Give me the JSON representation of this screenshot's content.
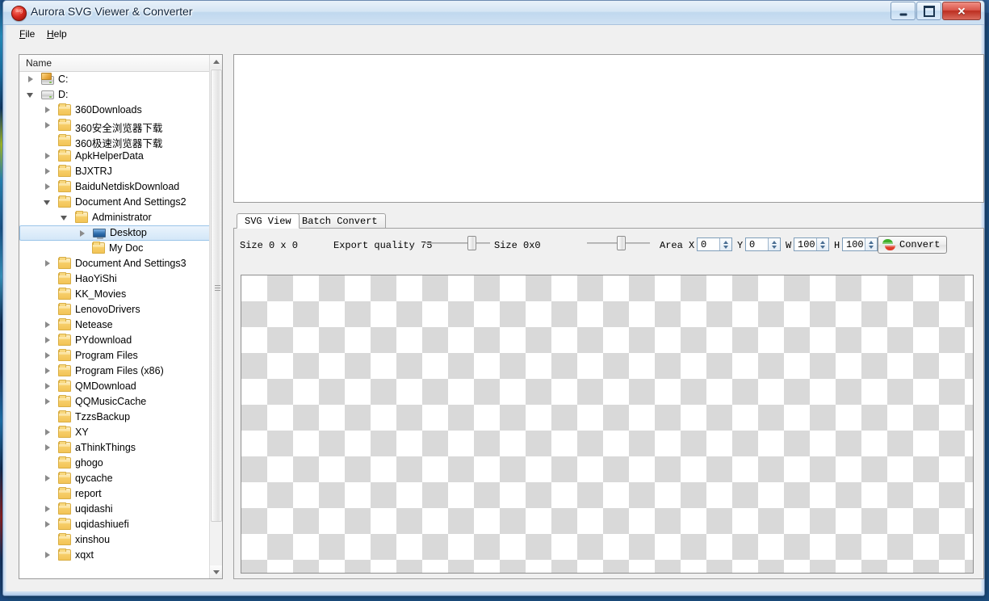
{
  "window": {
    "title": "Aurora SVG Viewer & Converter",
    "icon": "app-svg-icon",
    "buttons": {
      "minimize": "–",
      "maximize": "□",
      "close": "✕"
    }
  },
  "menubar": {
    "items": [
      {
        "label": "File",
        "mnemonic": "F"
      },
      {
        "label": "Help",
        "mnemonic": "H"
      }
    ]
  },
  "tree": {
    "header": "Name",
    "nodes": [
      {
        "label": "C:",
        "indent": 0,
        "icon": "drive-c-icon",
        "expander": "collapsed",
        "selected": false
      },
      {
        "label": "D:",
        "indent": 0,
        "icon": "drive-icon",
        "expander": "expanded",
        "selected": false
      },
      {
        "label": "360Downloads",
        "indent": 1,
        "icon": "folder-icon",
        "expander": "collapsed",
        "selected": false
      },
      {
        "label": "360安全浏览器下载",
        "indent": 1,
        "icon": "folder-icon",
        "expander": "collapsed",
        "selected": false
      },
      {
        "label": "360极速浏览器下载",
        "indent": 1,
        "icon": "folder-icon",
        "expander": "none",
        "selected": false
      },
      {
        "label": "ApkHelperData",
        "indent": 1,
        "icon": "folder-icon",
        "expander": "collapsed",
        "selected": false
      },
      {
        "label": "BJXTRJ",
        "indent": 1,
        "icon": "folder-icon",
        "expander": "collapsed",
        "selected": false
      },
      {
        "label": "BaiduNetdiskDownload",
        "indent": 1,
        "icon": "folder-icon",
        "expander": "collapsed",
        "selected": false
      },
      {
        "label": "Document And Settings2",
        "indent": 1,
        "icon": "folder-icon",
        "expander": "expanded",
        "selected": false
      },
      {
        "label": "Administrator",
        "indent": 2,
        "icon": "folder-icon",
        "expander": "expanded",
        "selected": false
      },
      {
        "label": "Desktop",
        "indent": 3,
        "icon": "monitor-icon",
        "expander": "collapsed",
        "selected": true
      },
      {
        "label": "My Doc",
        "indent": 3,
        "icon": "folder-icon",
        "expander": "none",
        "selected": false
      },
      {
        "label": "Document And Settings3",
        "indent": 1,
        "icon": "folder-icon",
        "expander": "collapsed",
        "selected": false
      },
      {
        "label": "HaoYiShi",
        "indent": 1,
        "icon": "folder-icon",
        "expander": "none",
        "selected": false
      },
      {
        "label": "KK_Movies",
        "indent": 1,
        "icon": "folder-icon",
        "expander": "none",
        "selected": false
      },
      {
        "label": "LenovoDrivers",
        "indent": 1,
        "icon": "folder-icon",
        "expander": "none",
        "selected": false
      },
      {
        "label": "Netease",
        "indent": 1,
        "icon": "folder-icon",
        "expander": "collapsed",
        "selected": false
      },
      {
        "label": "PYdownload",
        "indent": 1,
        "icon": "folder-icon",
        "expander": "collapsed",
        "selected": false
      },
      {
        "label": "Program Files",
        "indent": 1,
        "icon": "folder-icon",
        "expander": "collapsed",
        "selected": false
      },
      {
        "label": "Program Files (x86)",
        "indent": 1,
        "icon": "folder-icon",
        "expander": "collapsed",
        "selected": false
      },
      {
        "label": "QMDownload",
        "indent": 1,
        "icon": "folder-icon",
        "expander": "collapsed",
        "selected": false
      },
      {
        "label": "QQMusicCache",
        "indent": 1,
        "icon": "folder-icon",
        "expander": "collapsed",
        "selected": false
      },
      {
        "label": "TzzsBackup",
        "indent": 1,
        "icon": "folder-icon",
        "expander": "none",
        "selected": false
      },
      {
        "label": "XY",
        "indent": 1,
        "icon": "folder-icon",
        "expander": "collapsed",
        "selected": false
      },
      {
        "label": "aThinkThings",
        "indent": 1,
        "icon": "folder-icon",
        "expander": "collapsed",
        "selected": false
      },
      {
        "label": "ghogo",
        "indent": 1,
        "icon": "folder-icon",
        "expander": "none",
        "selected": false
      },
      {
        "label": "qycache",
        "indent": 1,
        "icon": "folder-icon",
        "expander": "collapsed",
        "selected": false
      },
      {
        "label": "report",
        "indent": 1,
        "icon": "folder-icon",
        "expander": "none",
        "selected": false
      },
      {
        "label": "uqidashi",
        "indent": 1,
        "icon": "folder-icon",
        "expander": "collapsed",
        "selected": false
      },
      {
        "label": "uqidashiuefi",
        "indent": 1,
        "icon": "folder-icon",
        "expander": "collapsed",
        "selected": false
      },
      {
        "label": "xinshou",
        "indent": 1,
        "icon": "folder-icon",
        "expander": "none",
        "selected": false
      },
      {
        "label": "xqxt",
        "indent": 1,
        "icon": "folder-icon",
        "expander": "collapsed",
        "selected": false
      }
    ]
  },
  "tabs": [
    {
      "label": "SVG View",
      "active": true
    },
    {
      "label": "Batch Convert",
      "active": false
    }
  ],
  "toolbar": {
    "size_label": "Size 0 x 0",
    "export_quality_label": "Export quality 75",
    "export_quality_value": 75,
    "size_out_label": "Size 0x0",
    "area_label": "Area",
    "x_label": "X",
    "x_value": "0",
    "y_label": "Y",
    "y_value": "0",
    "w_label": "W",
    "w_value": "100",
    "h_label": "H",
    "h_value": "100",
    "convert_label": "Convert",
    "convert_icon": "convert-arrows-icon"
  }
}
